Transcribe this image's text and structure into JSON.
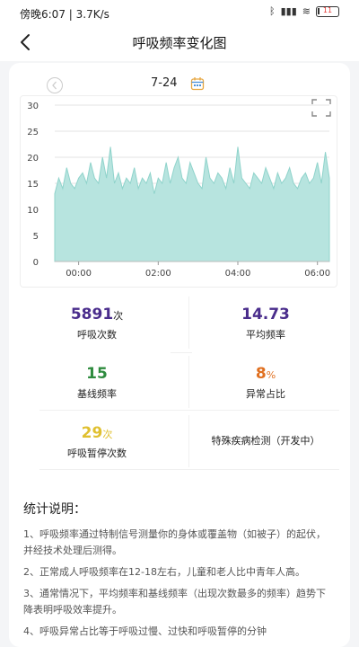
{
  "status_bar": {
    "time_text": "傍晚6:07 | 3.7K/s",
    "battery_level": 11,
    "battery_label": "11"
  },
  "header": {
    "title": "呼吸频率变化图",
    "back_icon": "chevron-left-icon"
  },
  "date_nav": {
    "date": "7-24",
    "prev_icon": "chevron-left-circle-icon",
    "calendar_icon": "calendar-icon",
    "fullscreen_icon": "fullscreen-icon"
  },
  "chart_data": {
    "type": "area",
    "xlabel": "",
    "ylabel": "",
    "ylim": [
      0,
      30
    ],
    "yticks": [
      "30",
      "25",
      "20",
      "15",
      "10",
      "5",
      "0"
    ],
    "xticks": [
      "00:00",
      "02:00",
      "04:00",
      "06:00"
    ],
    "xlim_hours": [
      -0.6,
      6.3
    ],
    "grid": true,
    "colors": {
      "fill": "#b7e4df",
      "line": "#8fd3cb"
    },
    "series": [
      {
        "x_hours": [
          -0.6,
          -0.5,
          -0.4,
          -0.3,
          -0.2,
          -0.1,
          0.0,
          0.1,
          0.2,
          0.3,
          0.4,
          0.5,
          0.6,
          0.7,
          0.8,
          0.9,
          1.0,
          1.1,
          1.2,
          1.3,
          1.4,
          1.5,
          1.6,
          1.7,
          1.8,
          1.9,
          2.0,
          2.1,
          2.2,
          2.3,
          2.4,
          2.5,
          2.6,
          2.7,
          2.8,
          2.9,
          3.0,
          3.1,
          3.2,
          3.3,
          3.4,
          3.5,
          3.6,
          3.7,
          3.8,
          3.9,
          4.0,
          4.1,
          4.2,
          4.3,
          4.4,
          4.5,
          4.6,
          4.7,
          4.8,
          4.9,
          5.0,
          5.1,
          5.2,
          5.3,
          5.4,
          5.5,
          5.6,
          5.7,
          5.8,
          5.9,
          6.0,
          6.1,
          6.2,
          6.3
        ],
        "values": [
          13,
          16,
          14,
          18,
          15,
          14,
          16,
          17,
          15,
          19,
          16,
          15,
          20,
          16,
          22,
          15,
          17,
          14,
          16,
          15,
          18,
          14,
          16,
          15,
          17,
          13,
          16,
          15,
          19,
          15,
          18,
          20,
          16,
          15,
          19,
          17,
          15,
          14,
          20,
          16,
          15,
          17,
          16,
          14,
          18,
          15,
          22,
          16,
          15,
          14,
          17,
          16,
          15,
          18,
          16,
          14,
          17,
          15,
          16,
          18,
          15,
          14,
          16,
          17,
          15,
          16,
          19,
          15,
          21,
          16
        ]
      }
    ]
  },
  "stats": [
    {
      "value": "5891",
      "unit": "次",
      "label": "呼吸次数",
      "color": "#4a2d8c"
    },
    {
      "value": "14.73",
      "unit": "",
      "label": "平均频率",
      "color": "#4a2d8c"
    },
    {
      "value": "15",
      "unit": "",
      "label": "基线频率",
      "color": "#2e8b3e"
    },
    {
      "value": "8",
      "unit": "%",
      "label": "异常占比",
      "color": "#e07020"
    },
    {
      "value": "29",
      "unit": "次",
      "label": "呼吸暂停次数",
      "color": "#e0c030"
    },
    {
      "value": "",
      "unit": "",
      "label": "特殊疾病检测（开发中）",
      "color": "#222222"
    }
  ],
  "notes": {
    "title": "统计说明：",
    "items": [
      "1、呼吸频率通过特制信号测量你的身体或覆盖物（如被子）的起伏，并经技术处理后测得。",
      "2、正常成人呼吸频率在12-18左右，儿童和老人比中青年人高。",
      "3、通常情况下，平均频率和基线频率（出现次数最多的频率）趋势下降表明呼吸效率提升。",
      "4、呼吸异常占比等于呼吸过慢、过快和呼吸暂停的分钟"
    ]
  }
}
